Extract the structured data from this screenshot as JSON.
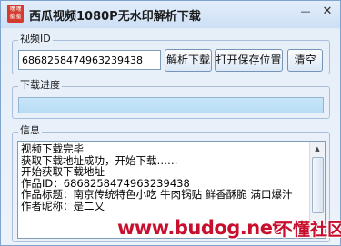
{
  "window": {
    "title": "西瓜视频1080P无水印解析下载",
    "icon_chars": [
      "嘿",
      "嘿",
      "羞",
      "羞"
    ],
    "minimize_glyph": "—",
    "close_glyph": "✕"
  },
  "video_id": {
    "group_label": "视频ID",
    "value": "6868258474963239438",
    "buttons": {
      "parse": "解析下载",
      "open_folder": "打开保存位置",
      "clear": "清空"
    }
  },
  "progress": {
    "group_label": "下载进度",
    "value_percent": 0
  },
  "info": {
    "group_label": "信息",
    "lines": [
      "视频下载完毕",
      "获取下载地址成功，开始下载……",
      "开始获取下载地址",
      "作品ID：6868258474963239438",
      "作品标题：南京传统特色小吃 牛肉锅贴 鲜香酥脆 满口爆汁",
      "作者昵称：是二又"
    ]
  },
  "watermark": {
    "url": "www.budog.net",
    "site": "不懂社区"
  }
}
